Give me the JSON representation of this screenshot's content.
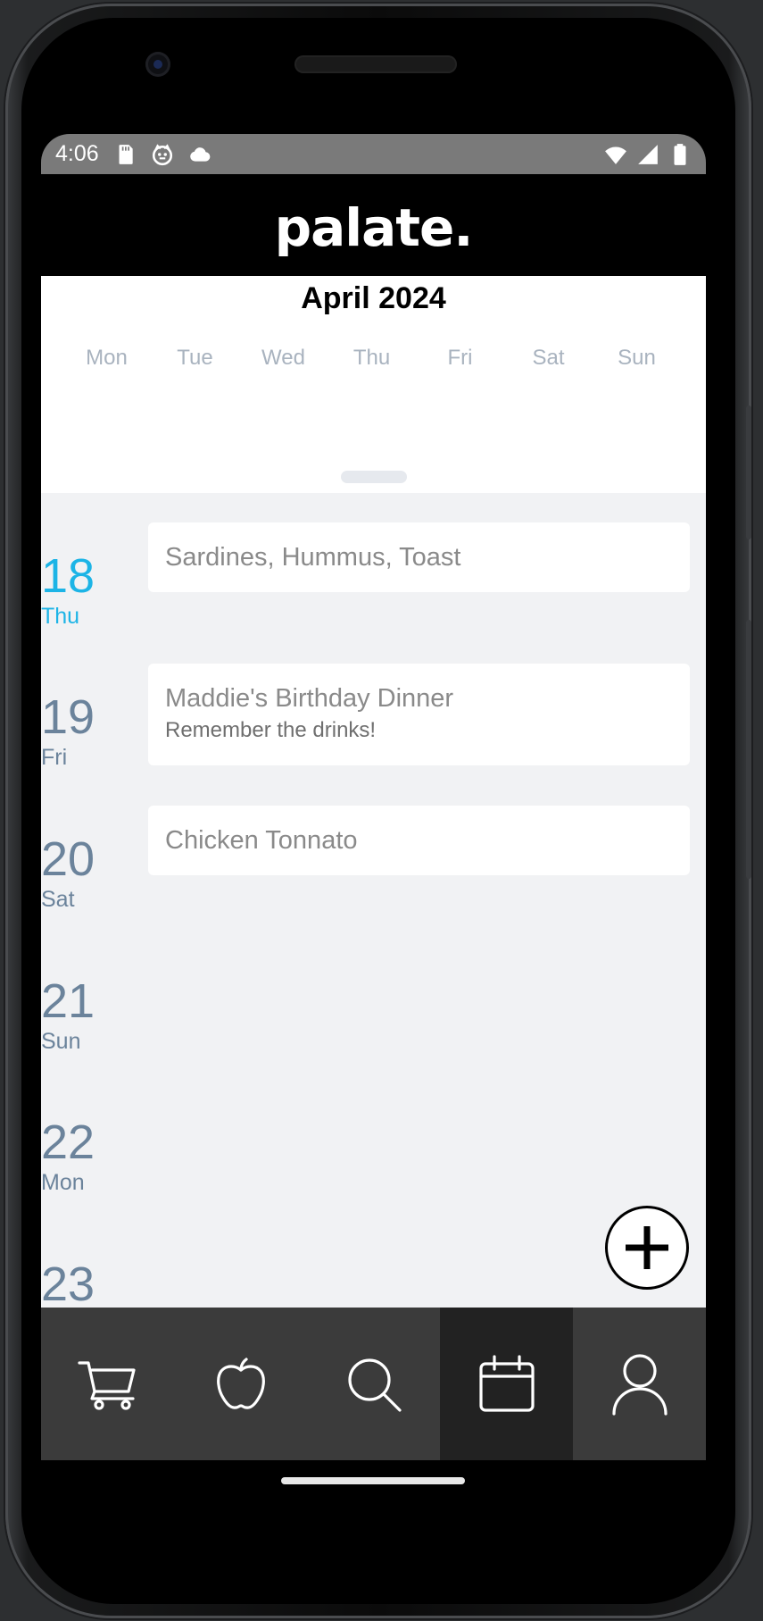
{
  "status_bar": {
    "time": "4:06",
    "left_icons": [
      "sd-card-icon",
      "cat-face-icon",
      "cloud-icon"
    ],
    "right_icons": [
      "wifi-icon",
      "signal-icon",
      "battery-icon"
    ]
  },
  "app": {
    "logo": "palate."
  },
  "calendar": {
    "month_title": "April 2024",
    "weekdays": [
      "Mon",
      "Tue",
      "Wed",
      "Thu",
      "Fri",
      "Sat",
      "Sun"
    ]
  },
  "agenda": {
    "days": [
      {
        "num": "18",
        "name": "Thu",
        "today": true,
        "event_title": "Sardines, Hummus, Toast",
        "event_note": ""
      },
      {
        "num": "19",
        "name": "Fri",
        "today": false,
        "event_title": "Maddie's Birthday Dinner",
        "event_note": "Remember the drinks!"
      },
      {
        "num": "20",
        "name": "Sat",
        "today": false,
        "event_title": "Chicken Tonnato",
        "event_note": ""
      },
      {
        "num": "21",
        "name": "Sun",
        "today": false,
        "event_title": "",
        "event_note": ""
      },
      {
        "num": "22",
        "name": "Mon",
        "today": false,
        "event_title": "",
        "event_note": ""
      },
      {
        "num": "23",
        "name": "",
        "today": false,
        "event_title": "",
        "event_note": ""
      }
    ]
  },
  "fab": {
    "icon": "plus-icon"
  },
  "bottom_nav": {
    "items": [
      {
        "icon": "cart-icon",
        "active": false
      },
      {
        "icon": "apple-icon",
        "active": false
      },
      {
        "icon": "search-icon",
        "active": false
      },
      {
        "icon": "calendar-icon",
        "active": true
      },
      {
        "icon": "profile-icon",
        "active": false
      }
    ]
  },
  "colors": {
    "today_accent": "#1cb4e6",
    "day_text": "#6b839b",
    "agenda_bg": "#f1f2f4",
    "nav_bg": "#3b3b3b",
    "nav_active_bg": "#222222"
  }
}
